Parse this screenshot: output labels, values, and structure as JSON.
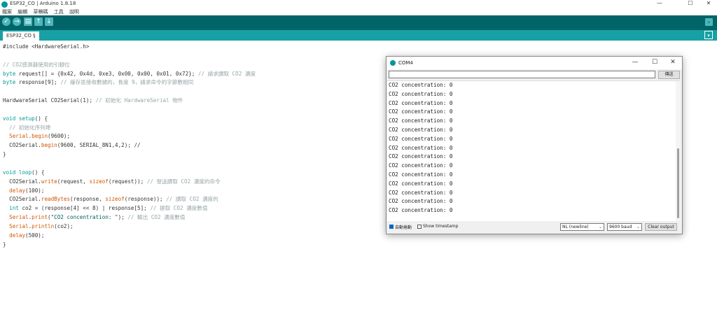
{
  "window": {
    "title": "ESP32_CO | Arduino 1.8.18",
    "minimize": "—",
    "maximize": "☐",
    "close": "✕"
  },
  "menu": [
    "檔案",
    "編輯",
    "草稿碼",
    "工具",
    "說明"
  ],
  "toolbar": {
    "verify": "✓",
    "upload": "→",
    "new": "▤",
    "open": "↑",
    "save": "↓",
    "serial_monitor": "⌕"
  },
  "tabs": [
    {
      "label": "ESP32_CO §"
    }
  ],
  "tab_menu": "▾",
  "code_lines": [
    [
      {
        "t": "#include <HardwareSerial.h>",
        "c": ""
      }
    ],
    [
      {
        "t": "",
        "c": ""
      }
    ],
    [
      {
        "t": "// CO2感測器使用的引腳位",
        "c": "cm"
      }
    ],
    [
      {
        "t": "byte",
        "c": "ty"
      },
      {
        "t": " request[] = {0x42, 0x4d, 0xe3, 0x00, 0x00, 0x01, 0x72}; ",
        "c": ""
      },
      {
        "t": "// 請求讀取 CO2 濃度",
        "c": "cm"
      }
    ],
    [
      {
        "t": "byte",
        "c": "ty"
      },
      {
        "t": " response[9]; ",
        "c": ""
      },
      {
        "t": "// 緩存區接收數據的，長度 9，請求命令的字節數相同",
        "c": "cm"
      }
    ],
    [
      {
        "t": "",
        "c": ""
      }
    ],
    [
      {
        "t": "HardwareSerial CO2Serial(1); ",
        "c": ""
      },
      {
        "t": "// 初始化 HardwareSerial 物件",
        "c": "cm"
      }
    ],
    [
      {
        "t": "",
        "c": ""
      }
    ],
    [
      {
        "t": "void",
        "c": "ty"
      },
      {
        "t": " ",
        "c": ""
      },
      {
        "t": "setup",
        "c": "kw"
      },
      {
        "t": "() {",
        "c": ""
      }
    ],
    [
      {
        "t": "  // 初始化序列埠",
        "c": "cm"
      }
    ],
    [
      {
        "t": "  ",
        "c": ""
      },
      {
        "t": "Serial",
        "c": "fn"
      },
      {
        "t": ".",
        "c": ""
      },
      {
        "t": "begin",
        "c": "fn"
      },
      {
        "t": "(9600);",
        "c": ""
      }
    ],
    [
      {
        "t": "  CO2Serial.",
        "c": ""
      },
      {
        "t": "begin",
        "c": "fn"
      },
      {
        "t": "(9600, SERIAL_8N1,4,2); //",
        "c": ""
      }
    ],
    [
      {
        "t": "}",
        "c": ""
      }
    ],
    [
      {
        "t": "",
        "c": ""
      }
    ],
    [
      {
        "t": "void",
        "c": "ty"
      },
      {
        "t": " ",
        "c": ""
      },
      {
        "t": "loop",
        "c": "kw"
      },
      {
        "t": "() {",
        "c": ""
      }
    ],
    [
      {
        "t": "  CO2Serial.",
        "c": ""
      },
      {
        "t": "write",
        "c": "fn"
      },
      {
        "t": "(request, ",
        "c": ""
      },
      {
        "t": "sizeof",
        "c": "fn"
      },
      {
        "t": "(request)); ",
        "c": ""
      },
      {
        "t": "// 發送讀取 CO2 濃度的命令",
        "c": "cm"
      }
    ],
    [
      {
        "t": "  ",
        "c": ""
      },
      {
        "t": "delay",
        "c": "fn"
      },
      {
        "t": "(100);",
        "c": ""
      }
    ],
    [
      {
        "t": "  CO2Serial.",
        "c": ""
      },
      {
        "t": "readBytes",
        "c": "fn"
      },
      {
        "t": "(response, ",
        "c": ""
      },
      {
        "t": "sizeof",
        "c": "fn"
      },
      {
        "t": "(response)); ",
        "c": ""
      },
      {
        "t": "// 讀取 CO2 濃度的",
        "c": "cm"
      }
    ],
    [
      {
        "t": "  ",
        "c": ""
      },
      {
        "t": "int",
        "c": "ty"
      },
      {
        "t": " co2 = (response[4] << 8) | response[5]; ",
        "c": ""
      },
      {
        "t": "// 提取 CO2 濃度數值",
        "c": "cm"
      }
    ],
    [
      {
        "t": "  ",
        "c": ""
      },
      {
        "t": "Serial",
        "c": "fn"
      },
      {
        "t": ".",
        "c": ""
      },
      {
        "t": "print",
        "c": "fn"
      },
      {
        "t": "(",
        "c": ""
      },
      {
        "t": "\"CO2 concentration: \"",
        "c": "st"
      },
      {
        "t": "); ",
        "c": ""
      },
      {
        "t": "// 輸出 CO2 濃度數值",
        "c": "cm"
      }
    ],
    [
      {
        "t": "  ",
        "c": ""
      },
      {
        "t": "Serial",
        "c": "fn"
      },
      {
        "t": ".",
        "c": ""
      },
      {
        "t": "println",
        "c": "fn"
      },
      {
        "t": "(co2);",
        "c": ""
      }
    ],
    [
      {
        "t": "  ",
        "c": ""
      },
      {
        "t": "delay",
        "c": "fn"
      },
      {
        "t": "(500);",
        "c": ""
      }
    ],
    [
      {
        "t": "}",
        "c": ""
      }
    ]
  ],
  "monitor": {
    "title": "COM4",
    "minimize": "—",
    "maximize": "☐",
    "close": "✕",
    "input_value": "",
    "send_label": "傳送",
    "output_lines": [
      "CO2 concentration: 0",
      "CO2 concentration: 0",
      "CO2 concentration: 0",
      "CO2 concentration: 0",
      "CO2 concentration: 0",
      "CO2 concentration: 0",
      "CO2 concentration: 0",
      "CO2 concentration: 0",
      "CO2 concentration: 0",
      "CO2 concentration: 0",
      "CO2 concentration: 0",
      "CO2 concentration: 0",
      "CO2 concentration: 0",
      "CO2 concentration: 0",
      "CO2 concentration: 0"
    ],
    "autoscroll_label": "自動捲動",
    "autoscroll_checked": true,
    "timestamp_label": "Show timestamp",
    "timestamp_checked": false,
    "line_ending": "NL (newline)",
    "baud": "9600 baud",
    "clear_label": "Clear output"
  }
}
